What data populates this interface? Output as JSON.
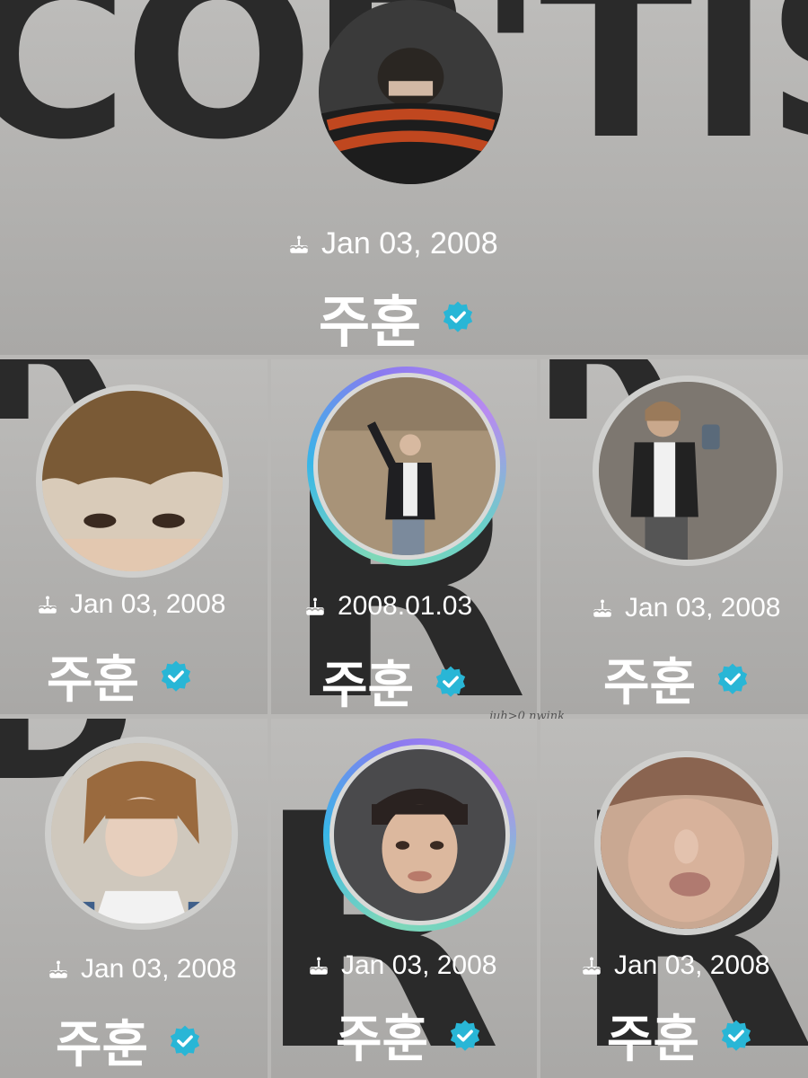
{
  "panels": [
    {
      "birthday": "Jan 03, 2008",
      "name": "주훈",
      "background_letters": "COR'TIS"
    },
    {
      "birthday": "Jan 03, 2008",
      "name": "주훈"
    },
    {
      "birthday": "2008.01.03",
      "name": "주훈"
    },
    {
      "birthday": "Jan 03, 2008",
      "name": "주훈"
    },
    {
      "birthday": "Jan 03, 2008",
      "name": "주훈"
    },
    {
      "birthday": "Jan 03, 2008",
      "name": "주훈"
    },
    {
      "birthday": "Jan 03, 2008",
      "name": "주훈"
    }
  ],
  "watermark": "juh>0 nwink",
  "colors": {
    "verified_badge": "#29b6d6",
    "ring_gradient": [
      "#7fd8b8",
      "#38b6e8",
      "#8a7af0"
    ],
    "text": "#ffffff"
  },
  "icons": {
    "birthday": "cake-icon",
    "verified": "verified-badge-icon"
  }
}
